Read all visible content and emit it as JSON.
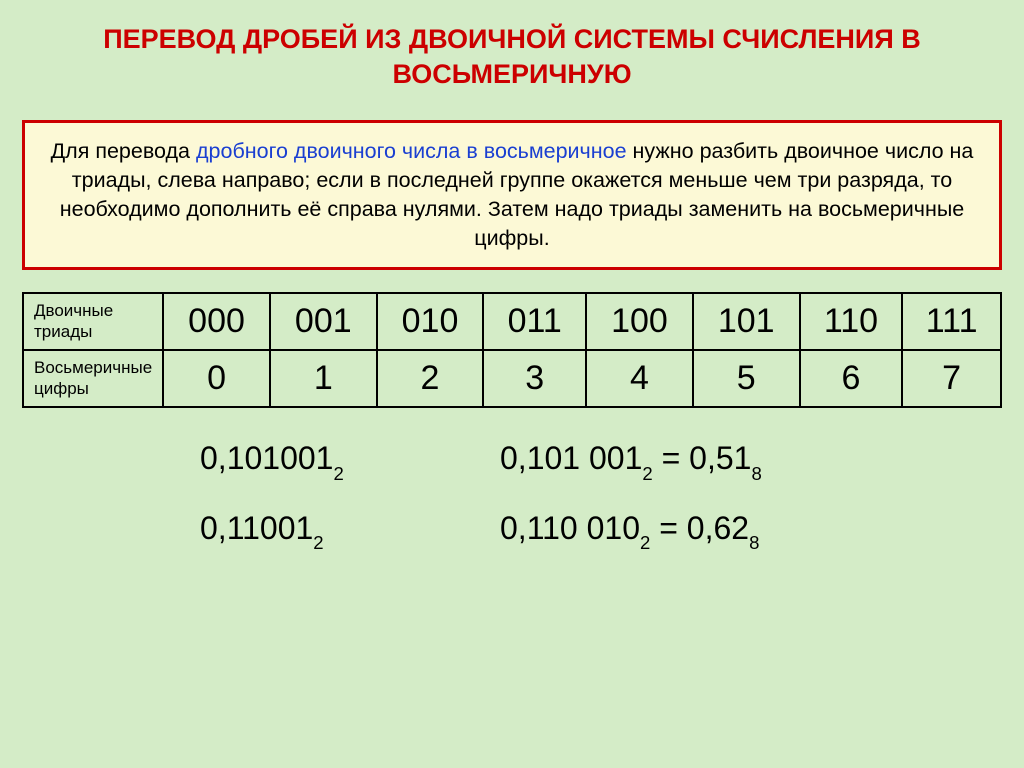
{
  "title": "ПЕРЕВОД ДРОБЕЙ ИЗ ДВОИЧНОЙ СИСТЕМЫ СЧИСЛЕНИЯ В ВОСЬМЕРИЧНУЮ",
  "rule": {
    "pre": "Для перевода ",
    "hl": "дробного двоичного числа в восьмеричное",
    "post": " нужно разбить двоичное число на триады, слева направо; если в последней группе окажется меньше чем три разряда, то необходимо дополнить её справа нулями. Затем надо триады заменить на восьмеричные цифры."
  },
  "table": {
    "row1_label": "Двоичные триады",
    "row2_label": "Восьмеричные цифры",
    "triads": [
      "000",
      "001",
      "010",
      "011",
      "100",
      "101",
      "110",
      "111"
    ],
    "octals": [
      "0",
      "1",
      "2",
      "3",
      "4",
      "5",
      "6",
      "7"
    ]
  },
  "chart_data": {
    "type": "table",
    "title": "Двоичные триады → Восьмеричные цифры",
    "categories": [
      "000",
      "001",
      "010",
      "011",
      "100",
      "101",
      "110",
      "111"
    ],
    "values": [
      0,
      1,
      2,
      3,
      4,
      5,
      6,
      7
    ]
  },
  "examples": [
    {
      "left_main": "0,101001",
      "left_sub": "2",
      "right_a_main": "0,101 001",
      "right_a_sub": "2",
      "eq": " = ",
      "right_b_main": "0,51",
      "right_b_sub": "8"
    },
    {
      "left_main": "0,11001",
      "left_sub": "2",
      "right_a_main": "0,110 010",
      "right_a_sub": "2",
      "eq": " = ",
      "right_b_main": "0,62",
      "right_b_sub": "8"
    }
  ]
}
